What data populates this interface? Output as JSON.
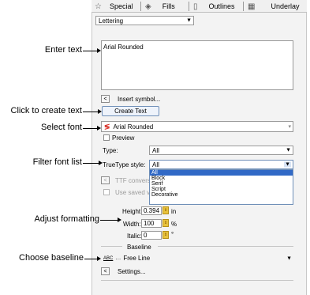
{
  "tabs": [
    {
      "label": "Special",
      "icon": "star-icon"
    },
    {
      "label": "Fills",
      "icon": "fill-icon"
    },
    {
      "label": "Outlines",
      "icon": "outline-icon"
    },
    {
      "label": "Underlay",
      "icon": "underlay-icon"
    }
  ],
  "mode_select": {
    "value": "Lettering"
  },
  "text_area": {
    "value": "Arial Rounded"
  },
  "insert_symbol": {
    "btn": "<",
    "label": "Insert symbol..."
  },
  "create_text": {
    "label": "Create Text"
  },
  "font_select": {
    "value": "Arial Rounded"
  },
  "preview": {
    "label": "Preview"
  },
  "type": {
    "label": "Type:",
    "value": "All"
  },
  "truetype_style": {
    "label": "TrueType style:",
    "value": "All",
    "options": [
      "All",
      "Block",
      "Serif",
      "Script",
      "Decorative"
    ]
  },
  "ttf_convert": {
    "btn": "<",
    "label": "TTF conversi"
  },
  "use_saved": {
    "label": "Use saved va"
  },
  "height": {
    "label": "Height:",
    "value": "0.394",
    "unit": "in"
  },
  "width": {
    "label": "Width:",
    "value": "100",
    "unit": "%"
  },
  "italic": {
    "label": "Italic:",
    "value": "0",
    "unit": "°"
  },
  "baseline": {
    "section_label": "Baseline",
    "icon_text": "ABC",
    "value": "Free Line"
  },
  "settings": {
    "btn": "<",
    "label": "Settings..."
  },
  "callouts": {
    "enter_text": "Enter text",
    "create_text": "Click to create text",
    "select_font": "Select font",
    "filter_font": "Filter font list",
    "adjust_format": "Adjust formatting",
    "choose_baseline": "Choose baseline"
  },
  "colors": {
    "accent": "#3169c6",
    "font_icon": "#d9342b",
    "spin": "#e8c23c"
  }
}
